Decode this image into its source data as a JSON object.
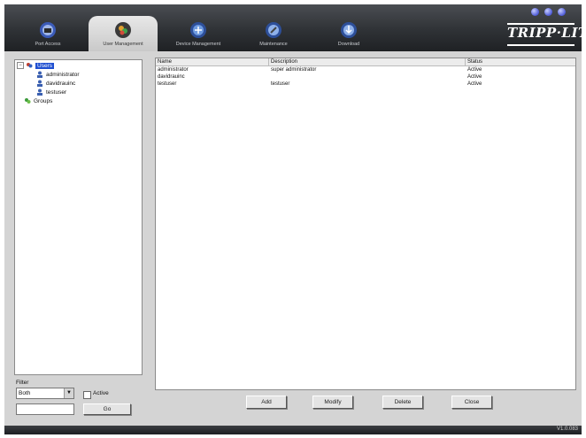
{
  "header": {
    "tabs": [
      {
        "label": "Port Access",
        "icon": "port-access-icon"
      },
      {
        "label": "User Management",
        "icon": "user-management-icon"
      },
      {
        "label": "Device Management",
        "icon": "device-management-icon"
      },
      {
        "label": "Maintenance",
        "icon": "maintenance-icon"
      },
      {
        "label": "Download",
        "icon": "download-icon"
      }
    ],
    "active_tab": "User Management",
    "logo_text": "TRIPP·LITE"
  },
  "tree": {
    "root_label": "Users",
    "users": [
      "administrator",
      "davidrauinc",
      "testuser"
    ],
    "groups_label": "Groups"
  },
  "filter": {
    "label": "Filter",
    "select_value": "Both",
    "active_label": "Active",
    "input_value": "",
    "go_label": "Go"
  },
  "grid": {
    "columns": [
      "Name",
      "Description",
      "Status"
    ],
    "rows": [
      {
        "name": "administrator",
        "description": "super administrator",
        "status": "Active"
      },
      {
        "name": "davidrauinc",
        "description": "",
        "status": "Active"
      },
      {
        "name": "testuser",
        "description": "testuser",
        "status": "Active"
      }
    ]
  },
  "actions": {
    "add": "Add",
    "modify": "Modify",
    "delete": "Delete",
    "close": "Close"
  },
  "status": {
    "version": "V1.0.083"
  },
  "colors": {
    "header_dark": "#2f3236",
    "selection": "#1f4fd1",
    "panel_bg": "#d4d4d4"
  }
}
